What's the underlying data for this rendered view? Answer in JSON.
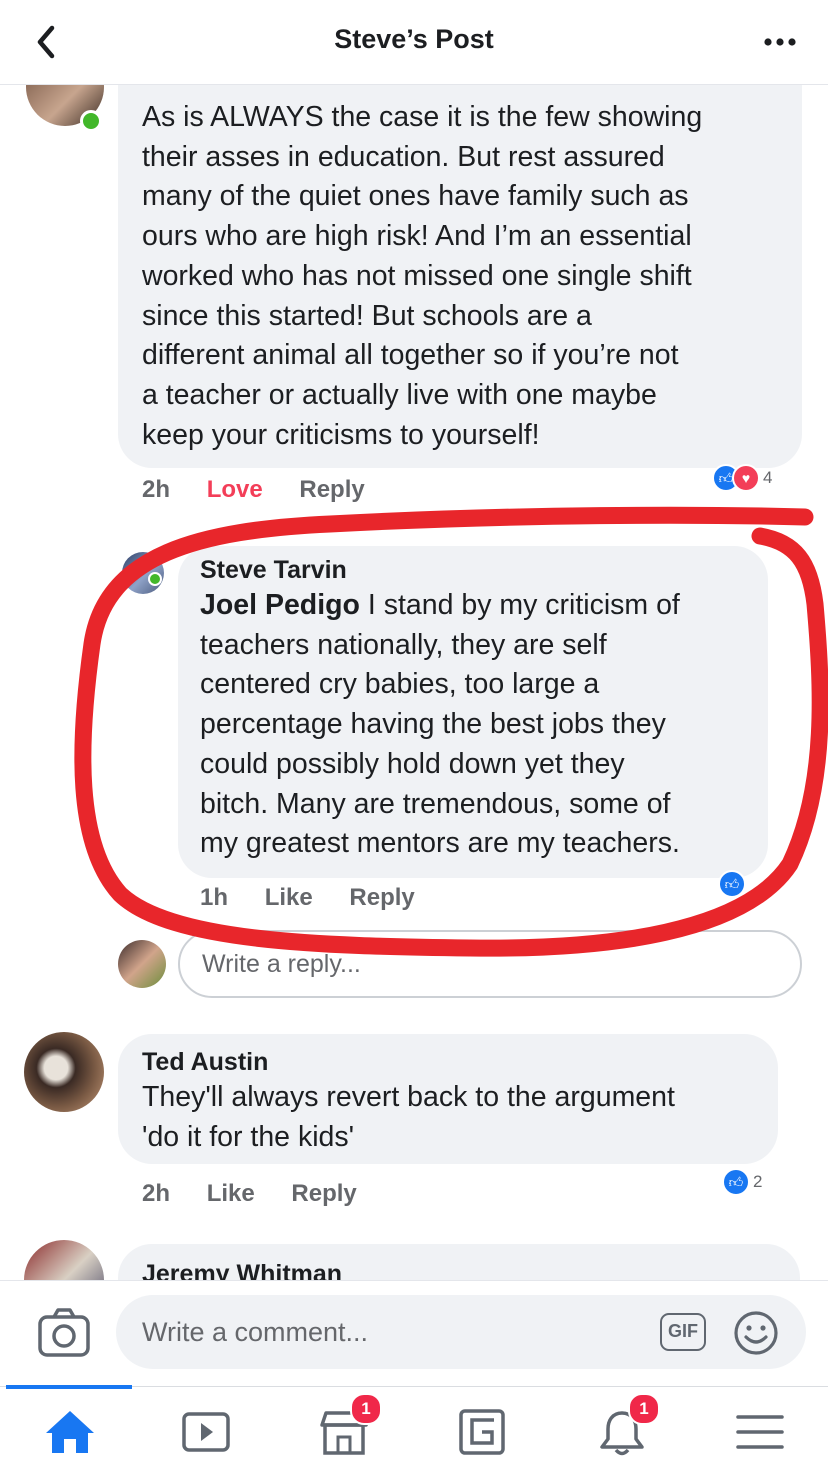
{
  "header": {
    "title": "Steve’s Post"
  },
  "comments": [
    {
      "author": "",
      "text": "As is ALWAYS the case it is the few showing\ntheir asses in education. But rest assured\nmany of the quiet ones have family such as\nours who are high risk!  And I’m an essential\nworked who has not missed one single shift\nsince this started!  But schools are a\ndifferent animal all together so if you’re not\na teacher or actually live with one maybe\nkeep your criticisms to yourself!",
      "time": "2h",
      "reaction_label": "Love",
      "reply_label": "Reply",
      "reaction_count": "4"
    },
    {
      "author": "Steve Tarvin",
      "mention": "Joel Pedigo",
      "text": " I stand by my criticism of\nteachers nationally, they are self\ncentered cry babies, too large a\npercentage having the best jobs they\ncould possibly hold down yet they\nbitch. Many are tremendous, some of\nmy greatest mentors are my teachers.",
      "time": "1h",
      "reaction_label": "Like",
      "reply_label": "Reply"
    },
    {
      "author": "Ted Austin",
      "text": "They'll always revert back to the argument\n'do it for the kids'",
      "time": "2h",
      "reaction_label": "Like",
      "reply_label": "Reply",
      "reaction_count": "2"
    },
    {
      "author": "Jeremy Whitman"
    }
  ],
  "reply_box": {
    "placeholder": "Write a reply..."
  },
  "composer": {
    "placeholder": "Write a comment...",
    "gif_label": "GIF"
  },
  "tabbar": {
    "tabs": [
      "home-icon",
      "watch-icon",
      "marketplace-icon",
      "groups-icon",
      "notifications-icon",
      "menu-icon"
    ],
    "marketplace_badge": "1",
    "notifications_badge": "1"
  },
  "colors": {
    "accent": "#1877f2",
    "love": "#f33e58",
    "annotation": "#e8262b"
  }
}
